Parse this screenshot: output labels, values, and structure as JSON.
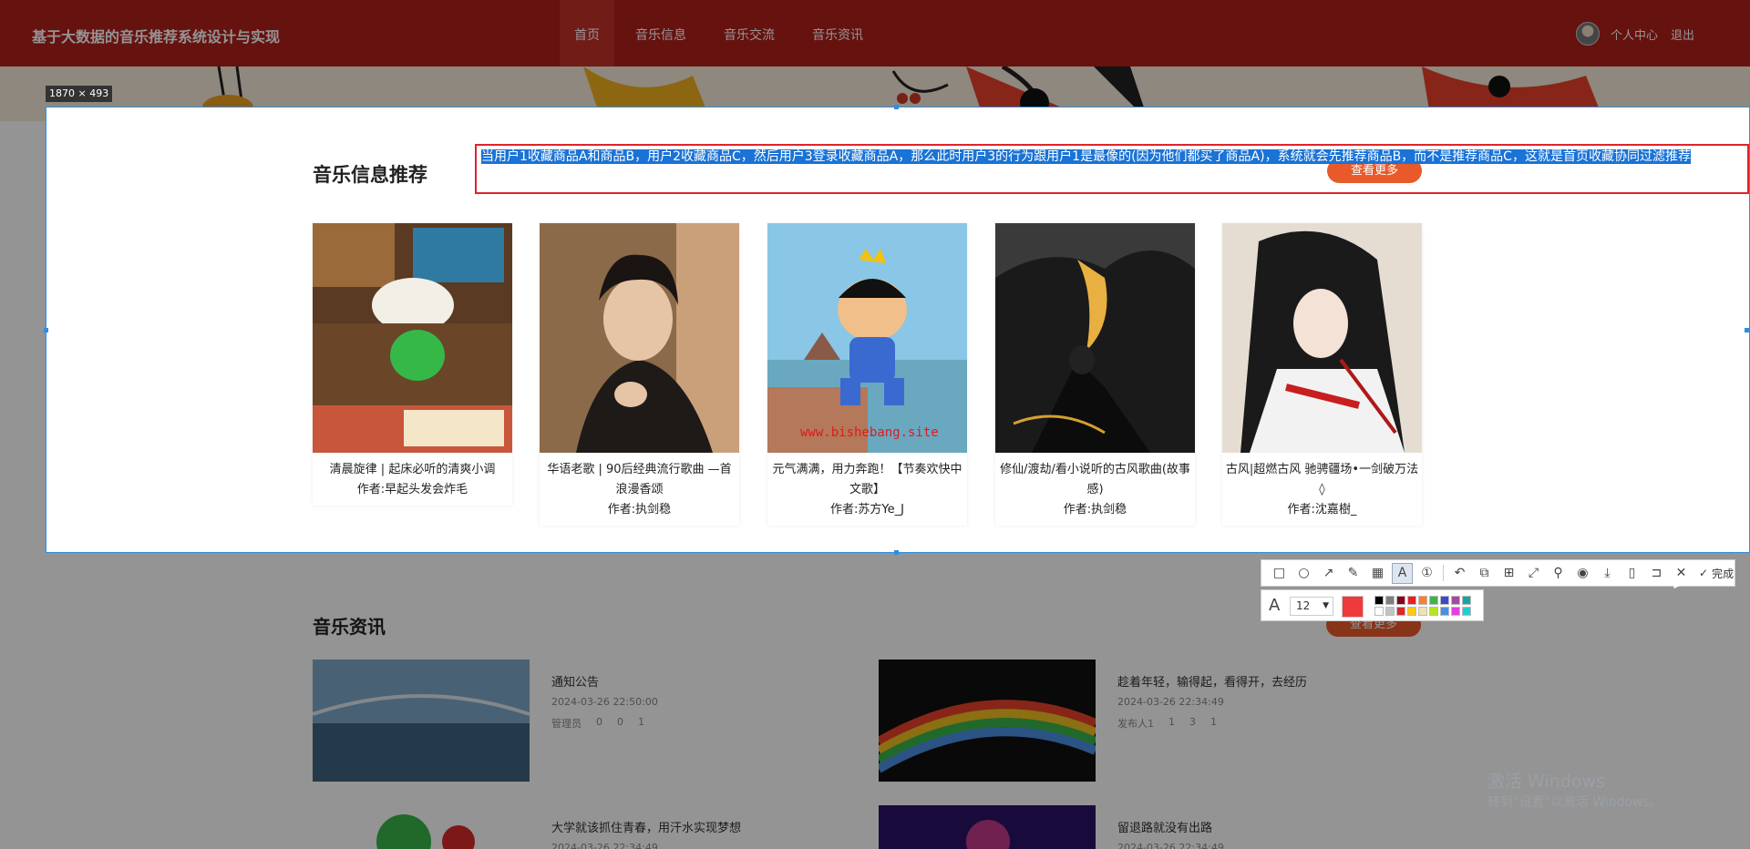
{
  "navbar": {
    "site_title": "基于大数据的音乐推荐系统设计与实现",
    "items": [
      "首页",
      "音乐信息",
      "音乐交流",
      "音乐资讯"
    ],
    "active_index": 0,
    "user_center": "个人中心",
    "logout": "退出"
  },
  "selection": {
    "size_label": "1870 × 493"
  },
  "recommend": {
    "title": "音乐信息推荐",
    "more_button": "查看更多",
    "cards": [
      {
        "title": "清晨旋律 | 起床必听的清爽小调",
        "author": "作者:早起头发会炸毛"
      },
      {
        "title": "华语老歌 | 90后经典流行歌曲 —首浪漫香颂",
        "author": "作者:执剑稳"
      },
      {
        "title": "元气满满，用力奔跑！【节奏欢快中文歌】",
        "author": "作者:苏方Ye_J"
      },
      {
        "title": "修仙/渡劫/看小说听的古风歌曲(故事感)",
        "author": "作者:执剑稳"
      },
      {
        "title": "古风|超燃古风 驰骋疆场•一剑破万法◊",
        "author": "作者:沈嘉樹_"
      }
    ],
    "watermark": "www.bishebang.site"
  },
  "annotation": {
    "text": "当用户1收藏商品A和商品B，用户2收藏商品C，然后用户3登录收藏商品A，那么此时用户3的行为跟用户1是最像的(因为他们都买了商品A)，系统就会先推荐商品B，而不是推荐商品C，这就是首页收藏协同过滤推荐",
    "box_color": "#e0232a"
  },
  "news": {
    "title": "音乐资讯",
    "more_button": "查看更多",
    "items": [
      {
        "title": "通知公告",
        "date": "2024-03-26 22:50:00",
        "author": "管理员",
        "likes": "0",
        "dislikes": "0",
        "comments": "1"
      },
      {
        "title": "趁着年轻，输得起，看得开，去经历",
        "date": "2024-03-26 22:34:49",
        "author": "发布人1",
        "likes": "1",
        "dislikes": "3",
        "comments": "1"
      },
      {
        "title": "大学就该抓住青春，用汗水实现梦想",
        "date": "2024-03-26 22:34:49"
      },
      {
        "title": "留退路就没有出路",
        "date": "2024-03-26 22:34:49"
      }
    ]
  },
  "toolbar": {
    "tools": [
      "rectangle-icon",
      "ellipse-icon",
      "arrow-icon",
      "pencil-icon",
      "mosaic-icon",
      "text-icon",
      "number-icon",
      "undo-icon",
      "ocr-icon",
      "translate-icon",
      "scroll-capture-icon",
      "pin-icon",
      "record-icon",
      "download-icon",
      "phone-icon",
      "bookmark-icon",
      "close-icon"
    ],
    "selected_tool": "text-icon",
    "done_label": "完成",
    "font_size": "12",
    "current_color": "#ee3a3a",
    "palette": [
      "#000000",
      "#7f7f7f",
      "#880015",
      "#ed1c24",
      "#ff7f27",
      "#3ab54a",
      "#3f48cc",
      "#a349a4",
      "#15a6a0",
      "#ffffff",
      "#c3c3c3",
      "#d82a2a",
      "#ffc90e",
      "#efe4b0",
      "#b5e61d",
      "#4a90e2",
      "#e040e0",
      "#1fcfd0"
    ]
  },
  "windows": {
    "activate_title": "激活 Windows",
    "activate_hint": "转到\"设置\"以激活 Windows。"
  },
  "colors": {
    "nav_red": "#b01f1a",
    "accent_orange": "#e85a2a",
    "selection_blue": "#2e8fe0"
  }
}
